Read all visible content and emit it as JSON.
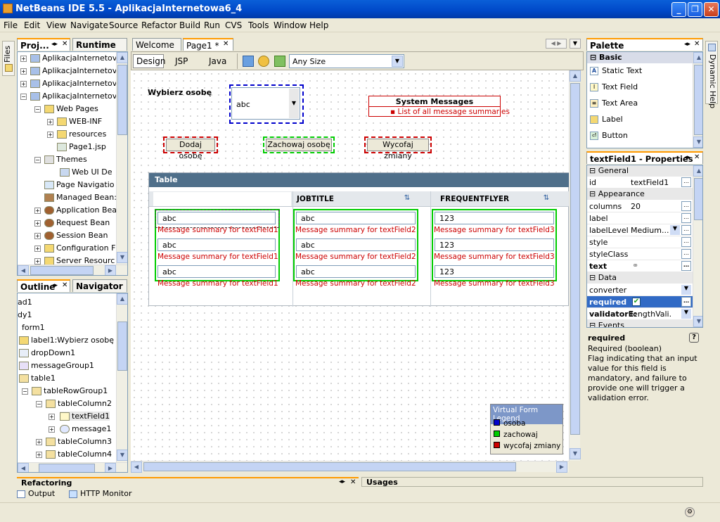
{
  "window": {
    "title": "NetBeans IDE 5.5 - AplikacjaInternetowa6_4"
  },
  "menu": [
    "File",
    "Edit",
    "View",
    "Navigate",
    "Source",
    "Refactor",
    "Build",
    "Run",
    "CVS",
    "Tools",
    "Window",
    "Help"
  ],
  "left_strip": {
    "files": "Files"
  },
  "projects": {
    "tabs": {
      "projects": "Proj...",
      "runtime": "Runtime"
    },
    "items": [
      "AplikacjaInternetov",
      "AplikacjaInternetov",
      "AplikacjaInternetov",
      "AplikacjaInternetov",
      "Web Pages",
      "WEB-INF",
      "resources",
      "Page1.jsp",
      "Themes",
      "Web UI De",
      "Page Navigatio",
      "Managed Bean:",
      "Application Bea",
      "Request Bean",
      "Session Bean",
      "Configuration F",
      "Server Resourc"
    ]
  },
  "outline": {
    "tabs": {
      "outline": "Outline",
      "navigator": "Navigator"
    },
    "items": [
      "ad1",
      "dy1",
      "form1",
      "label1:Wybierz osobę",
      "dropDown1",
      "messageGroup1",
      "table1",
      "tableRowGroup1",
      "tableColumn2",
      "textField1",
      "message1",
      "tableColumn3",
      "tableColumn4"
    ]
  },
  "editor": {
    "tabs": {
      "welcome": "Welcome",
      "page1": "Page1 *"
    },
    "toolbar": {
      "design": "Design",
      "jsp": "JSP",
      "java": "Java",
      "size": "Any Size"
    }
  },
  "form": {
    "label": "Wybierz osobę",
    "dropdown_value": "abc",
    "system_messages_title": "System Messages",
    "system_messages_item": "List of all message summaries",
    "btn_add": "Dodaj osobę",
    "btn_save": "Zachowaj osobę",
    "btn_revert": "Wycofaj zmiany",
    "table_title": "Table",
    "col2": "JOBTITLE",
    "col3": "FREQUENTFLYER",
    "cells": {
      "c1": "abc",
      "c2": "abc",
      "c3": "123"
    },
    "msgs": {
      "m1": "Message summary for textField1",
      "m2": "Message summary for textField2",
      "m3": "Message summary for textField3"
    }
  },
  "legend": {
    "title": "Virtual Form Legend",
    "items": [
      {
        "label": "osoba",
        "color": "#0000cc"
      },
      {
        "label": "zachowaj",
        "color": "#00cc00"
      },
      {
        "label": "wycofaj zmiany",
        "color": "#cc0000"
      }
    ]
  },
  "palette": {
    "title": "Palette",
    "category": "Basic",
    "items": [
      "Static Text",
      "Text Field",
      "Text Area",
      "Label",
      "Button"
    ]
  },
  "properties": {
    "title": "textField1 - Properties",
    "cats": {
      "general": "General",
      "appearance": "Appearance",
      "data": "Data",
      "events": "Events"
    },
    "rows": {
      "id": {
        "k": "id",
        "v": "textField1"
      },
      "columns": {
        "k": "columns",
        "v": "20"
      },
      "label": {
        "k": "label",
        "v": ""
      },
      "labelLevel": {
        "k": "labelLevel",
        "v": "Medium..."
      },
      "style": {
        "k": "style",
        "v": ""
      },
      "styleClass": {
        "k": "styleClass",
        "v": ""
      },
      "text": {
        "k": "text",
        "v": ""
      },
      "converter": {
        "k": "converter",
        "v": ""
      },
      "required": {
        "k": "required",
        "v": ""
      },
      "validator": {
        "k": "validatorE:",
        "v": "lengthVali..."
      }
    },
    "help_title": "required",
    "help_type": "Required (boolean)",
    "help_text": "Flag indicating that an input value for this field is mandatory, and  failure to provide one will trigger a validation error."
  },
  "right_strip": {
    "dynamic_help": "Dynamic Help"
  },
  "bottom": {
    "refactoring": "Refactoring",
    "usages": "Usages",
    "output": "Output",
    "http_monitor": "HTTP Monitor"
  }
}
